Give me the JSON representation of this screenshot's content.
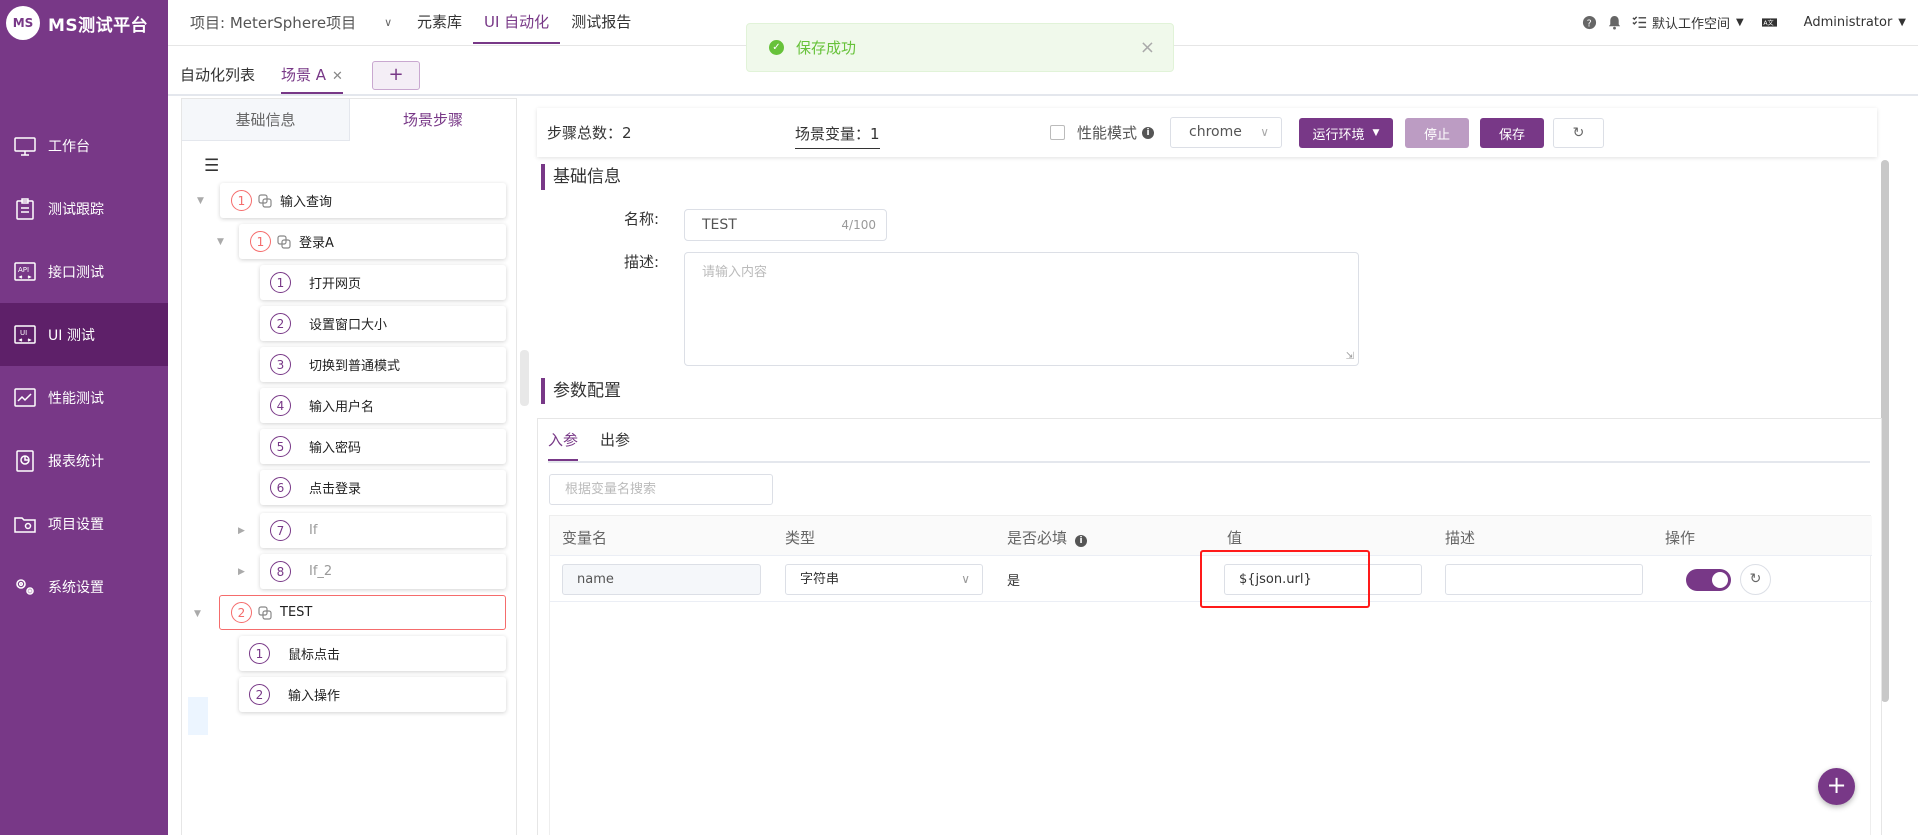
{
  "app": {
    "logo_mark": "MS",
    "title": "MS测试平台"
  },
  "sidebar": {
    "items": [
      {
        "label": "工作台",
        "icon": "monitor-icon"
      },
      {
        "label": "测试跟踪",
        "icon": "clipboard-icon"
      },
      {
        "label": "接口测试",
        "icon": "api-icon"
      },
      {
        "label": "UI 测试",
        "icon": "ui-icon"
      },
      {
        "label": "性能测试",
        "icon": "performance-chart-icon"
      },
      {
        "label": "报表统计",
        "icon": "report-icon"
      },
      {
        "label": "项目设置",
        "icon": "folder-settings-icon"
      },
      {
        "label": "系统设置",
        "icon": "gears-icon"
      }
    ],
    "active_index": 3
  },
  "topbar": {
    "project": "项目: MeterSphere项目",
    "nav": [
      "元素库",
      "UI 自动化",
      "测试报告"
    ],
    "active_nav": 1,
    "workspace": "默认工作空间",
    "user": "Administrator"
  },
  "toast": {
    "message": "保存成功"
  },
  "tabs": {
    "list": "自动化列表",
    "scene": "场景 A",
    "add": "+"
  },
  "left_panel": {
    "tabs": [
      "基础信息",
      "场景步骤"
    ],
    "active_tab": 1,
    "tree": [
      {
        "num": "1",
        "label": "输入查询"
      },
      {
        "num": "1",
        "label": "登录A"
      },
      {
        "num": "1",
        "label": "打开网页"
      },
      {
        "num": "2",
        "label": "设置窗口大小"
      },
      {
        "num": "3",
        "label": "切换到普通模式"
      },
      {
        "num": "4",
        "label": "输入用户名"
      },
      {
        "num": "5",
        "label": "输入密码"
      },
      {
        "num": "6",
        "label": "点击登录"
      },
      {
        "num": "7",
        "label": "If"
      },
      {
        "num": "8",
        "label": "If_2"
      },
      {
        "num": "2",
        "label": "TEST"
      },
      {
        "num": "1",
        "label": "鼠标点击"
      },
      {
        "num": "2",
        "label": "输入操作"
      }
    ]
  },
  "toolbar": {
    "steps_label": "步骤总数：",
    "steps_count": "2",
    "var_label": "场景变量：",
    "var_count": "1",
    "perf_label": "性能模式",
    "browser": "chrome",
    "env_label": "运行环境",
    "stop_label": "停止",
    "save_label": "保存"
  },
  "basic": {
    "section_title": "基础信息",
    "name_label": "名称:",
    "name_value": "TEST",
    "name_count": "4/100",
    "desc_label": "描述:",
    "desc_placeholder": "请输入内容"
  },
  "params": {
    "section_title": "参数配置",
    "tabs": [
      "入参",
      "出参"
    ],
    "search_placeholder": "根据变量名搜索",
    "columns": [
      "变量名",
      "类型",
      "是否必填",
      "值",
      "描述",
      "操作"
    ],
    "row": {
      "name": "name",
      "type": "字符串",
      "required": "是",
      "value": "${json.url}",
      "desc": "",
      "enabled": true
    }
  },
  "colors": {
    "brand": "#783887",
    "success": "#67c23a",
    "highlight": "#ff1a1a"
  }
}
